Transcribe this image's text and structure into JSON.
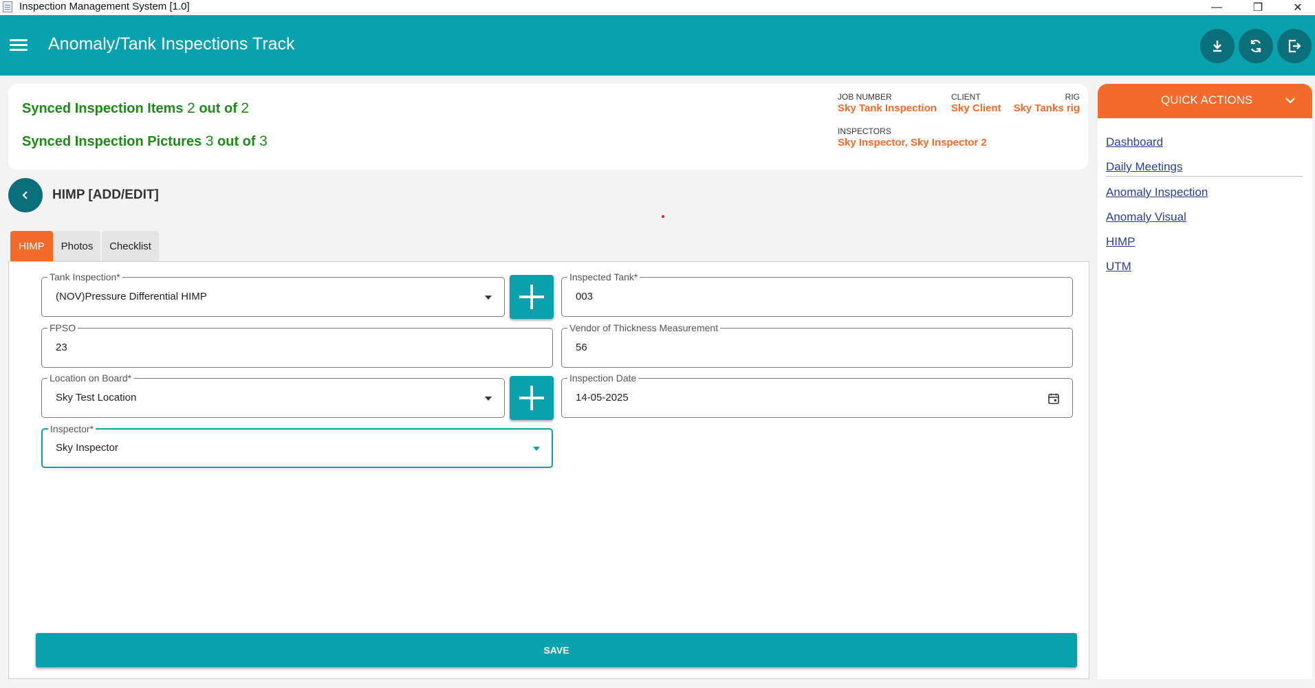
{
  "window": {
    "title": "Inspection Management System [1.0]",
    "minimize": "—",
    "maximize": "❐",
    "close": "✕"
  },
  "header": {
    "title": "Anomaly/Tank Inspections Track",
    "actions": [
      "download-icon",
      "sync-icon",
      "logout-icon"
    ]
  },
  "sync": {
    "items_label": "Synced Inspection Items",
    "items_done": "2",
    "out_of": "out of",
    "items_total": "2",
    "pictures_label": "Synced Inspection Pictures",
    "pictures_done": "3",
    "pictures_total": "3"
  },
  "job": {
    "job_number_label": "JOB NUMBER",
    "job_number": "Sky Tank Inspection",
    "client_label": "CLIENT",
    "client": "Sky Client",
    "rig_label": "RIG",
    "rig": "Sky Tanks rig",
    "inspectors_label": "INSPECTORS",
    "inspectors": "Sky Inspector, Sky Inspector 2"
  },
  "section": {
    "title": "HIMP [ADD/EDIT]"
  },
  "tabs": [
    {
      "label": "HIMP",
      "active": true
    },
    {
      "label": "Photos",
      "active": false
    },
    {
      "label": "Checklist",
      "active": false
    }
  ],
  "form": {
    "tank_inspection": {
      "label": "Tank Inspection*",
      "value": "(NOV)Pressure Differential HIMP"
    },
    "inspected_tank": {
      "label": "Inspected Tank*",
      "value": "003"
    },
    "fpso": {
      "label": "FPSO",
      "value": "23"
    },
    "vendor": {
      "label": "Vendor of Thickness Measurement",
      "value": "56"
    },
    "location": {
      "label": "Location on Board*",
      "value": "Sky Test Location"
    },
    "inspection_date": {
      "label": "Inspection Date",
      "value": "14-05-2025"
    },
    "inspector": {
      "label": "Inspector*",
      "value": "Sky Inspector"
    },
    "save_label": "SAVE"
  },
  "quick_actions": {
    "title": "QUICK ACTIONS",
    "links": [
      "Dashboard",
      "Daily Meetings",
      "Anomaly Inspection",
      "Anomaly Visual",
      "HIMP",
      "UTM"
    ]
  },
  "colors": {
    "primary": "#0aa1af",
    "primary_dark": "#0b6f79",
    "accent": "#f26b2a",
    "success": "#1d8a18",
    "link": "#2a3f8f"
  }
}
